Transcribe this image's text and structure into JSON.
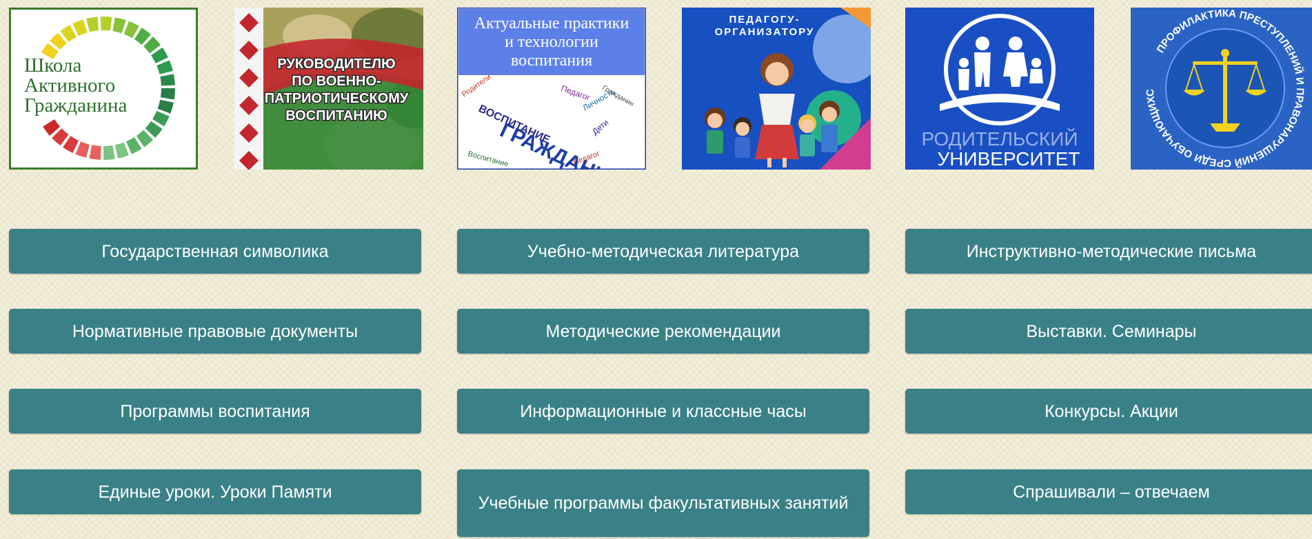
{
  "banners": {
    "school": {
      "lines": [
        "Школа",
        "Активного",
        "Гражданина"
      ]
    },
    "military": {
      "lines": [
        "РУКОВОДИТЕЛЮ",
        "ПО ВОЕННО-",
        "ПАТРИОТИЧЕСКОМУ",
        "ВОСПИТАНИЮ"
      ]
    },
    "practices": {
      "lines": [
        "Актуальные практики",
        "и технологии",
        "воспитания"
      ],
      "cloud_big": [
        "ГРАЖДАНИН",
        "ВОСПИТАНИЕ"
      ],
      "cloud_small": [
        "Родители",
        "Педагог",
        "Личность",
        "Дети",
        "Воспитание",
        "Педагог",
        "Гражданин"
      ]
    },
    "organizer": {
      "lines": [
        "ПЕДАГОГУ-",
        "ОРГАНИЗАТОРУ"
      ]
    },
    "parents": {
      "lines": [
        "РОДИТЕЛЬСКИЙ",
        "УНИВЕРСИТЕТ"
      ]
    },
    "prevention": {
      "ring_text": "ПРОФИЛАКТИКА ПРЕСТУПЛЕНИЙ И ПРАВОНАРУШЕНИЙ СРЕДИ ОБУЧАЮЩИХСЯ"
    }
  },
  "buttons": [
    {
      "label": "Государственная символика"
    },
    {
      "label": "Учебно-методическая литература"
    },
    {
      "label": "Инструктивно-методические письма"
    },
    {
      "label": "Нормативные правовые документы"
    },
    {
      "label": "Методические рекомендации"
    },
    {
      "label": "Выставки. Семинары"
    },
    {
      "label": "Программы воспитания"
    },
    {
      "label": "Информационные и классные часы"
    },
    {
      "label": "Конкурсы. Акции"
    },
    {
      "label": "Единые уроки. Уроки Памяти"
    },
    {
      "label": "Учебные программы факультативных занятий"
    },
    {
      "label": "Спрашивали – отвечаем"
    }
  ],
  "colors": {
    "button_bg": "#3a8187",
    "page_bg": "#f3eed9",
    "school_green": "#2e6e2e",
    "royal_blue": "#1749b8"
  }
}
